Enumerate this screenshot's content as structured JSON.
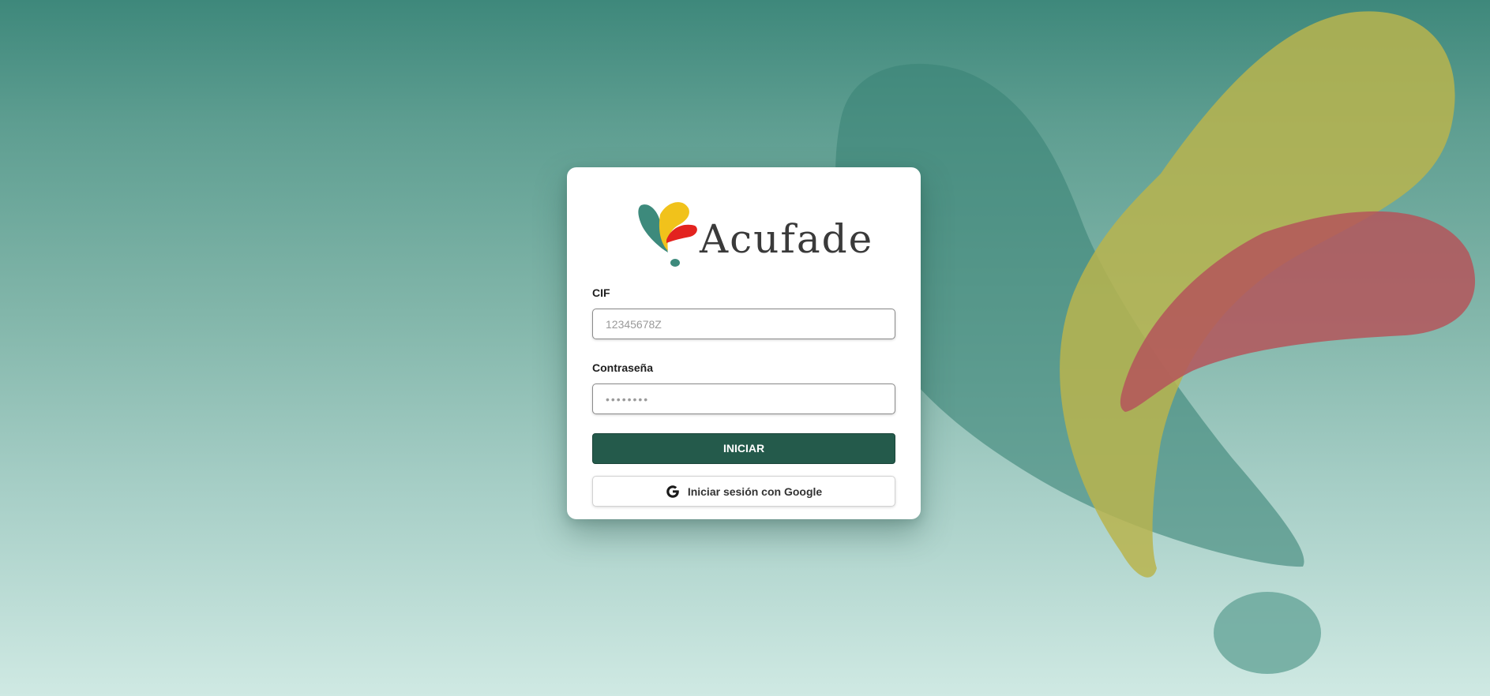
{
  "colors": {
    "background_top": "#3e887b",
    "background_bottom": "#cfe9e3",
    "primary_button": "#245a4b",
    "logo_teal": "#3d8a7c",
    "logo_yellow": "#f1c21b",
    "logo_red": "#e3231f"
  },
  "logo": {
    "brand_name": "Acufade",
    "icon": "acufade-logo-mark"
  },
  "form": {
    "cif_label": "CIF",
    "cif_placeholder": "12345678Z",
    "cif_value": "",
    "password_label": "Contraseña",
    "password_placeholder": "••••••••",
    "password_value": "",
    "submit_label": "INICIAR",
    "google_label": "Iniciar sesión con Google",
    "google_icon": "google-icon"
  }
}
